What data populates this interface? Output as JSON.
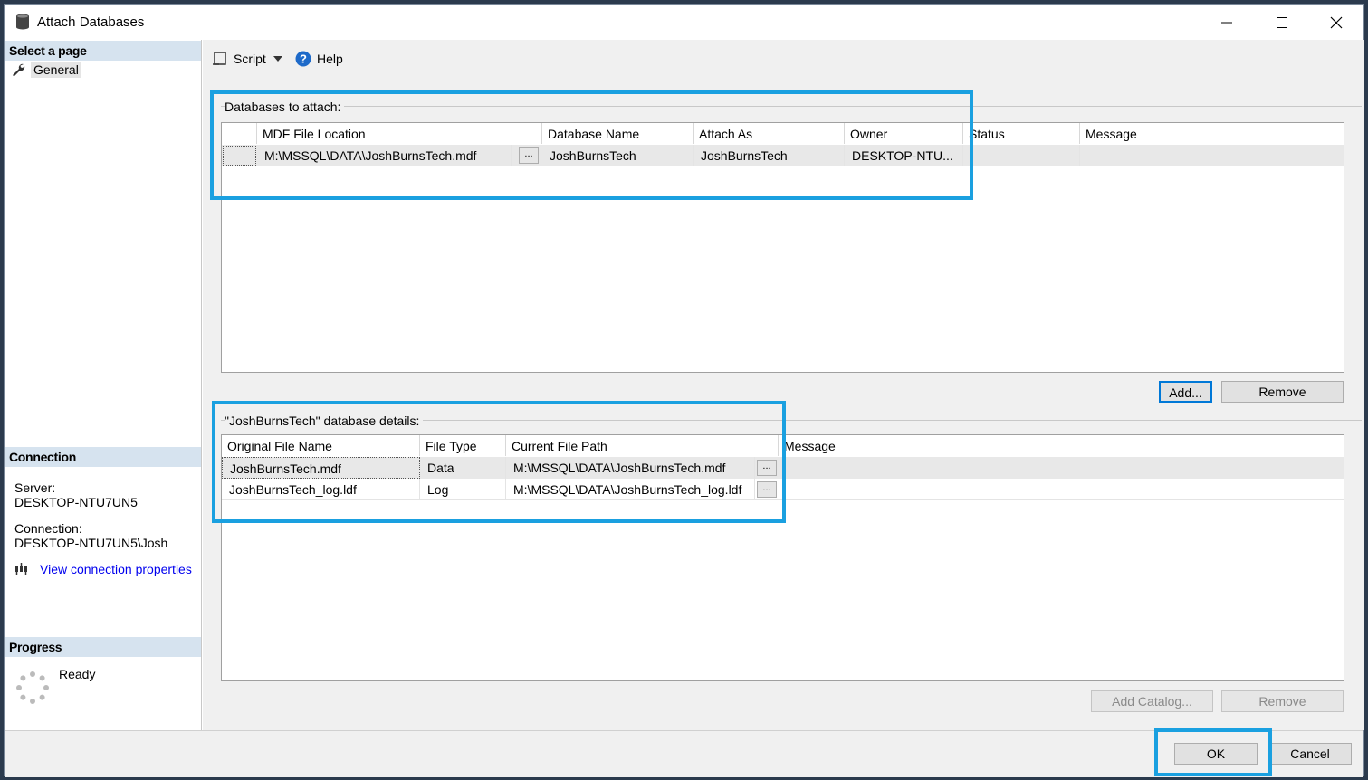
{
  "window": {
    "title": "Attach Databases"
  },
  "left": {
    "select_page": "Select a page",
    "pages": [
      "General"
    ],
    "connection_header": "Connection",
    "server_label": "Server:",
    "server_value": "DESKTOP-NTU7UN5",
    "connection_label": "Connection:",
    "connection_value": "DESKTOP-NTU7UN5\\Josh",
    "view_props": "View connection properties",
    "progress_header": "Progress",
    "progress_status": "Ready"
  },
  "toolbar": {
    "script": "Script",
    "help": "Help"
  },
  "attach": {
    "label": "Databases to attach:",
    "columns": [
      "MDF File Location",
      "Database Name",
      "Attach As",
      "Owner",
      "Status",
      "Message"
    ],
    "rows": [
      {
        "mdf": "M:\\MSSQL\\DATA\\JoshBurnsTech.mdf",
        "dbname": "JoshBurnsTech",
        "attach_as": "JoshBurnsTech",
        "owner": "DESKTOP-NTU...",
        "status": "",
        "message": ""
      }
    ],
    "ellipsis": "...",
    "add": "Add...",
    "remove": "Remove"
  },
  "details": {
    "label": "\"JoshBurnsTech\" database details:",
    "columns": [
      "Original File Name",
      "File Type",
      "Current File Path",
      "Message"
    ],
    "rows": [
      {
        "name": "JoshBurnsTech.mdf",
        "type": "Data",
        "path": "M:\\MSSQL\\DATA\\JoshBurnsTech.mdf",
        "message": ""
      },
      {
        "name": "JoshBurnsTech_log.ldf",
        "type": "Log",
        "path": "M:\\MSSQL\\DATA\\JoshBurnsTech_log.ldf",
        "message": ""
      }
    ],
    "ellipsis": "...",
    "add_catalog": "Add Catalog...",
    "remove": "Remove"
  },
  "footer": {
    "ok": "OK",
    "cancel": "Cancel"
  },
  "colors": {
    "accent": "#1aa0e0",
    "section_header": "#d6e3ef",
    "link": "#0000ee",
    "focus": "#0078d7"
  }
}
